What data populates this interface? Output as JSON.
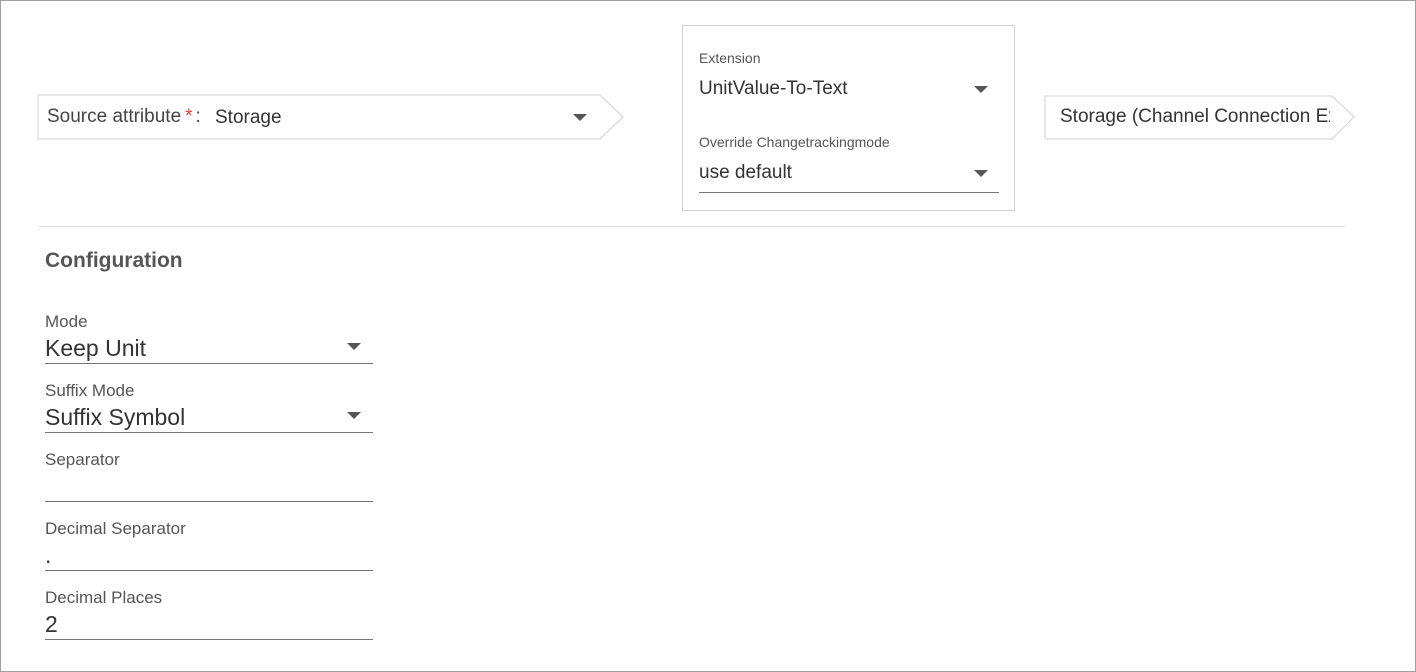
{
  "mapping": {
    "source": {
      "label": "Source attribute",
      "required_mark": "*",
      "separator": ":",
      "value": "Storage"
    },
    "extension": {
      "label": "Extension",
      "value": "UnitValue-To-Text",
      "override_label": "Override Changetrackingmode",
      "override_value": "use default"
    },
    "target": {
      "value": "Storage (Channel Connection Export)"
    }
  },
  "configuration": {
    "title": "Configuration",
    "fields": [
      {
        "label": "Mode",
        "value": "Keep Unit",
        "type": "select"
      },
      {
        "label": "Suffix Mode",
        "value": "Suffix Symbol",
        "type": "select"
      },
      {
        "label": "Separator",
        "value": "",
        "type": "text"
      },
      {
        "label": "Decimal Separator",
        "value": ".",
        "type": "text"
      },
      {
        "label": "Decimal Places",
        "value": "2",
        "type": "text"
      }
    ]
  },
  "colors": {
    "required": "#e53935",
    "border": "#d0d0d0",
    "underline": "#757575"
  }
}
